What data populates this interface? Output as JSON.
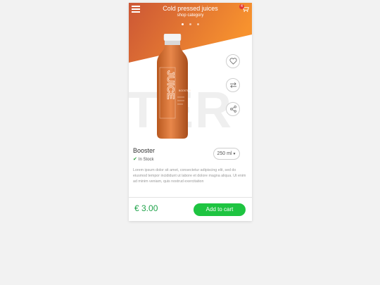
{
  "header": {
    "title": "Cold pressed juices",
    "subtitle": "shop category",
    "cart_count": "4"
  },
  "carousel": {
    "slides": 3,
    "active_index": 0
  },
  "hero": {
    "watermark_text": "TER",
    "bottle_label": {
      "brand": "JUICE",
      "flavor": "BOOSTER"
    }
  },
  "actions": [
    {
      "name": "favorite",
      "icon": "heart-icon"
    },
    {
      "name": "compare",
      "icon": "swap-arrows-icon"
    },
    {
      "name": "share",
      "icon": "share-icon"
    }
  ],
  "product": {
    "name": "Booster",
    "stock_status": "In Stock",
    "size": "250 ml",
    "description": "Lorem ipsum dolor sit amet, consectetur adipiscing elit, sed do eiusmod tempor incididunt ut labore et dolore magna aliqua. Ut enim ad minim veniam, quis nostrud exercitation"
  },
  "footer": {
    "price": "€ 3.00",
    "add_to_cart_label": "Add to cart"
  },
  "colors": {
    "header_gradient_start": "#cd5a35",
    "header_gradient_end": "#f5902f",
    "price": "#1fa34a",
    "cta": "#1ec441",
    "badge": "#e53935"
  }
}
